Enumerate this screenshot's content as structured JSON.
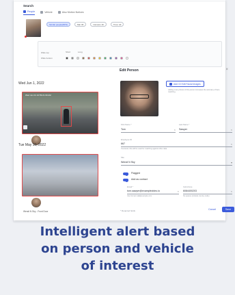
{
  "search": {
    "title": "Search",
    "tabs": [
      {
        "label": "People",
        "active": true
      },
      {
        "label": "Vehicle",
        "active": false
      },
      {
        "label": "Also Motion Notices",
        "active": false
      }
    ],
    "chips": [
      "Similar people(60%)",
      "Mar 06",
      "Camera: All",
      "Time: All"
    ],
    "filter_rows": [
      "Wide top",
      "Wide bottom"
    ],
    "style_labels": [
      "Short",
      "Long"
    ],
    "colors": [
      "#1a1a1a",
      "#7a7a7a",
      "#d9d9d9",
      "#8a5a2b",
      "#d33b3b",
      "#e67e22",
      "#f1c40f",
      "#27ae60",
      "#2980b9",
      "#8e44ad",
      "#e84393",
      "#ffffff"
    ]
  },
  "edit_person": {
    "title": "Edit Person",
    "add_face_button": "Add Or Edit Facial Images",
    "face_hint": "Adding more photos of this person increases the accuracy of face matching.",
    "first_name_label": "First Name *",
    "first_name": "Tom",
    "last_name_label": "Last Name *",
    "last_name": "Sawyer",
    "employee_id_label": "Employee ID",
    "employee_id": "667",
    "employee_hint": "If entered, this will be used for matching against other data",
    "site_label": "Site",
    "site": "Wendi N Sky",
    "flagged_label": "Flagged",
    "contact_label": "Add as contact",
    "email_label": "Email *",
    "email": "tom.sawyer@examplevideo.io",
    "email_hint": "Use format mail@example.com",
    "phone_label": "Cell phone",
    "phone": "6084400203",
    "phone_hint": "No spaces (include country code)",
    "footer_note": "* Required fields",
    "cancel_label": "Cancel",
    "save_label": "Save"
  },
  "sightings": [
    {
      "date": "Wed Jun 1, 2022",
      "overlay": "Wed Jun 01 10:59:21.99 AM"
    },
    {
      "date": "Tue May 10, 2022",
      "overlay": ""
    }
  ],
  "sighting_person_name": "Wendi N Sky - Front Door",
  "caption": {
    "line1": "Intelligent alert based",
    "line2": "on person and vehicle",
    "line3": "of interest"
  }
}
